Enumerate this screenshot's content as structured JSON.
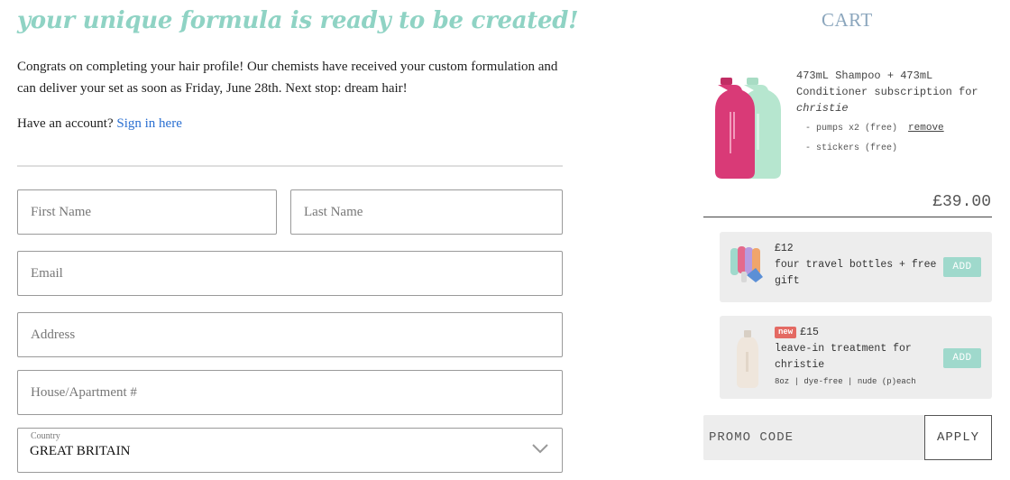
{
  "signup": {
    "headline": "your unique formula is ready to be created!",
    "intro": "Congrats on completing your hair profile! Our chemists have received your custom formulation and can deliver your set as soon as Friday, June 28th. Next stop: dream hair!",
    "account_prompt": "Have an account?",
    "sign_in_link": "Sign in here",
    "fields": {
      "first_name": "First Name",
      "last_name": "Last Name",
      "email": "Email",
      "address": "Address",
      "house": "House/Apartment #"
    },
    "country_label": "Country",
    "country_value": "GREAT BRITAIN"
  },
  "cart": {
    "title": "CART",
    "product_title": "473mL Shampoo + 473mL Conditioner subscription for",
    "product_for": "christie",
    "extras": [
      {
        "label": "- pumps x2 (free)",
        "action": "remove"
      },
      {
        "label": "- stickers (free)"
      }
    ],
    "price": "£39.00",
    "upsells": [
      {
        "price": "£12",
        "name": "four travel bottles + free gift",
        "button": "ADD"
      },
      {
        "badge": "new",
        "price": "£15",
        "name": "leave-in treatment for christie",
        "note": "8oz | dye-free | nude (p)each",
        "button": "ADD"
      }
    ],
    "promo_placeholder": "PROMO CODE",
    "apply_label": "APPLY"
  },
  "colors": {
    "headline": "#8fd3c4",
    "link": "#2a6fd1",
    "cart_title": "#8ba6bd",
    "add_button": "#9fd9cc",
    "new_badge": "#e46a63",
    "shampoo_bottle": "#d93a77",
    "conditioner_bottle": "#b6e6cf"
  }
}
